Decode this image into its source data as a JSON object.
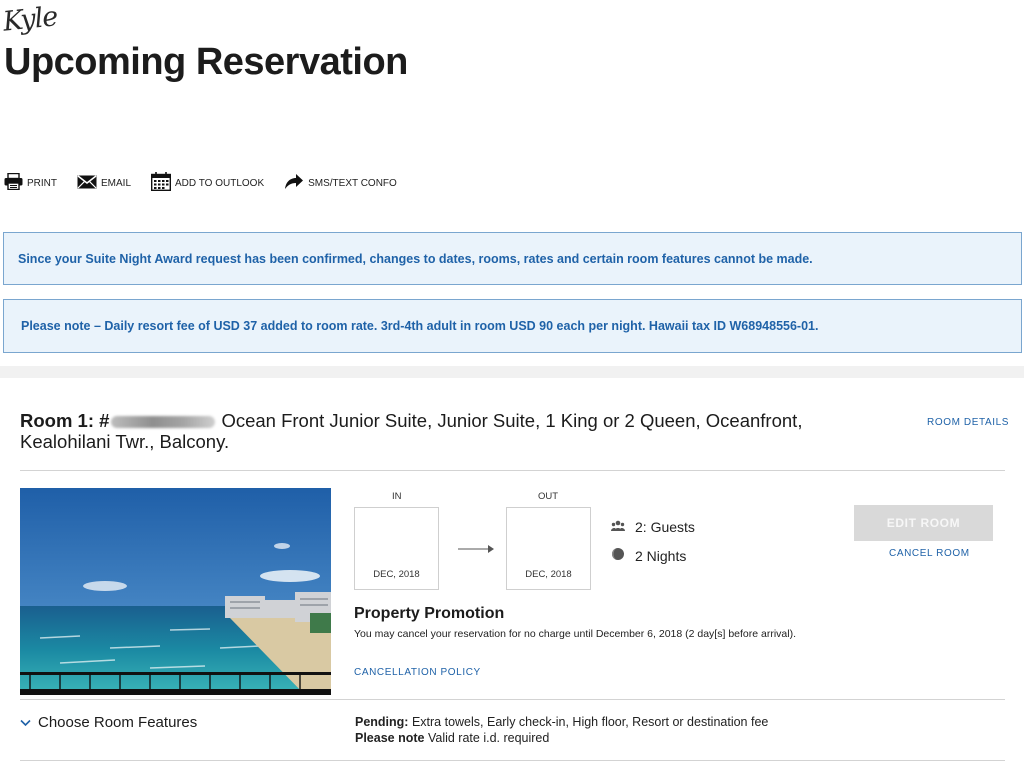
{
  "signature": "Kyle",
  "page_title": "Upcoming Reservation",
  "actions": [
    {
      "label": "PRINT",
      "icon": "printer-icon"
    },
    {
      "label": "EMAIL",
      "icon": "envelope-icon"
    },
    {
      "label": "ADD TO OUTLOOK",
      "icon": "calendar-icon"
    },
    {
      "label": "SMS/TEXT CONFO",
      "icon": "share-arrow-icon"
    }
  ],
  "notices": {
    "suite_night": "Since your Suite Night Award request has been confirmed, changes to dates, rooms, rates and certain room features cannot be made.",
    "resort_fee": "Please note –  Daily resort fee of USD 37 added to room rate. 3rd-4th adult in room USD 90 each per night. Hawaii tax ID W68948556-01."
  },
  "room": {
    "label": "Room 1: #",
    "name": "Ocean Front Junior Suite, Junior Suite, 1 King or 2 Queen, Oceanfront, Kealohilani Twr., Balcony.",
    "details_link": "ROOM DETAILS",
    "in_label": "IN",
    "out_label": "OUT",
    "check_in_month": "DEC, 2018",
    "check_out_month": "DEC, 2018",
    "guests": "2: Guests",
    "nights": "2 Nights",
    "edit_button": "EDIT ROOM",
    "cancel_link": "CANCEL ROOM",
    "promo_title": "Property Promotion",
    "promo_text": "You may cancel your reservation for no charge until December 6, 2018 (2 day[s] before arrival).",
    "cancellation_policy": "CANCELLATION POLICY"
  },
  "features": {
    "toggle_label": "Choose Room Features",
    "pending_label": "Pending:",
    "pending_items": "Extra towels,  Early check-in,  High floor,  Resort or destination fee",
    "note_label": "Please note",
    "note_text": "Valid rate i.d. required"
  },
  "colors": {
    "accent": "#1f62a8",
    "notice_bg": "#eaf3fb",
    "notice_border": "#7aa6cf",
    "button_disabled": "#d9d9d9"
  }
}
